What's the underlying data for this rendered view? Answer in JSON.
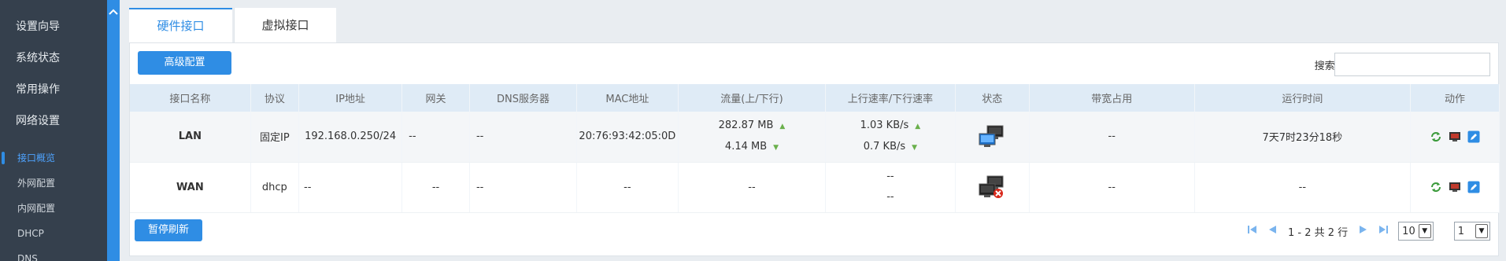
{
  "sidebar": {
    "menu": [
      {
        "label": "设置向导"
      },
      {
        "label": "系统状态"
      },
      {
        "label": "常用操作"
      },
      {
        "label": "网络设置"
      }
    ],
    "submenu": [
      {
        "label": "接口概览",
        "active": true
      },
      {
        "label": "外网配置"
      },
      {
        "label": "内网配置"
      },
      {
        "label": "DHCP"
      },
      {
        "label": "DNS"
      }
    ]
  },
  "tabs": [
    {
      "label": "硬件接口",
      "active": true
    },
    {
      "label": "虚拟接口"
    }
  ],
  "toolbar": {
    "advanced_label": "高级配置",
    "search_label": "搜索:",
    "search_value": ""
  },
  "table": {
    "headers": [
      "接口名称",
      "协议",
      "IP地址",
      "网关",
      "DNS服务器",
      "MAC地址",
      "流量(上/下行)",
      "上行速率/下行速率",
      "状态",
      "带宽占用",
      "运行时间",
      "动作"
    ],
    "rows": [
      {
        "name": "LAN",
        "protocol": "固定IP",
        "ip": "192.168.0.250/24",
        "gateway": "--",
        "dns": "--",
        "mac": "20:76:93:42:05:0D",
        "traffic_up": "282.87 MB",
        "traffic_down": "4.14 MB",
        "rate_up": "1.03 KB/s",
        "rate_down": "0.7 KB/s",
        "status": "connected",
        "bandwidth": "--",
        "uptime": "7天7时23分18秒"
      },
      {
        "name": "WAN",
        "protocol": "dhcp",
        "ip": "--",
        "gateway": "--",
        "dns": "--",
        "mac": "--",
        "traffic": "--",
        "rate_up": "--",
        "rate_down": "--",
        "status": "disconnected",
        "bandwidth": "--",
        "uptime": "--"
      }
    ]
  },
  "footer": {
    "pause_label": "暂停刷新",
    "page_info": "1 - 2 共 2 行",
    "page_size": "10",
    "page_number": "1"
  },
  "icons": {
    "up_arrow": "up-arrow-icon",
    "down_arrow": "down-arrow-icon",
    "refresh": "refresh-icon",
    "terminal": "terminal-icon",
    "edit": "edit-icon"
  }
}
